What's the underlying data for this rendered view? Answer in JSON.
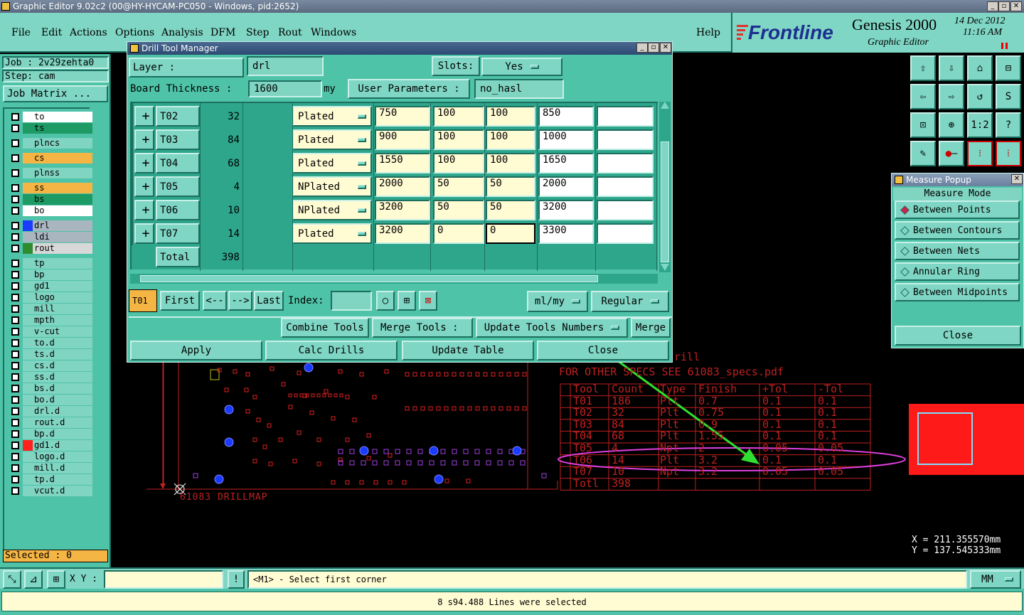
{
  "window": {
    "title": "Graphic Editor 9.02c2 (00@HY-HYCAM-PC050 - Windows, pid:2652)"
  },
  "menu": [
    "File",
    "Edit",
    "Actions",
    "Options",
    "Analysis",
    "DFM",
    "Step",
    "Rout",
    "Windows"
  ],
  "help_label": "Help",
  "brand": {
    "logo": "Frontline",
    "product": "Genesis 2000",
    "subtitle": "Graphic Editor",
    "date": "14 Dec 2012",
    "time": "11:16 AM"
  },
  "left": {
    "job": "Job : 2v29zehta0",
    "step": "Step: cam",
    "job_matrix": "Job Matrix ...",
    "selected": "Selected : 0",
    "layers": [
      {
        "name": "to",
        "color": "#ffffff",
        "bg": "#ffffff"
      },
      {
        "name": "ts",
        "color": "#1e9a64",
        "bg": "#1e9a64"
      },
      {
        "name": "plncs",
        "color": "#80d4c2",
        "bg": "#80d4c2"
      },
      {
        "name": "cs",
        "color": "#f5b544",
        "bg": "#f5b544"
      },
      {
        "name": "plnss",
        "color": "#80d4c2",
        "bg": "#80d4c2"
      },
      {
        "name": "ss",
        "color": "#f5b544",
        "bg": "#f5b544"
      },
      {
        "name": "bs",
        "color": "#1e9a64",
        "bg": "#1e9a64"
      },
      {
        "name": "bo",
        "color": "#ffffff",
        "bg": "#ffffff"
      },
      {
        "name": "drl",
        "color": "#1a3cff",
        "bg": "#a9b6c0"
      },
      {
        "name": "ldi",
        "color": "#a9b6c0",
        "bg": "#a9b6c0"
      },
      {
        "name": "rout",
        "color": "#2e8b2e",
        "bg": "#d8d8d8"
      },
      {
        "name": "tp",
        "color": "#80d4c2",
        "bg": "#80d4c2"
      },
      {
        "name": "bp",
        "color": "#80d4c2",
        "bg": "#80d4c2"
      },
      {
        "name": "gd1",
        "color": "#80d4c2",
        "bg": "#80d4c2"
      },
      {
        "name": "logo",
        "color": "#80d4c2",
        "bg": "#80d4c2"
      },
      {
        "name": "mill",
        "color": "#80d4c2",
        "bg": "#80d4c2"
      },
      {
        "name": "mpth",
        "color": "#80d4c2",
        "bg": "#80d4c2"
      },
      {
        "name": "v-cut",
        "color": "#80d4c2",
        "bg": "#80d4c2"
      },
      {
        "name": "to.d",
        "color": "#80d4c2",
        "bg": "#80d4c2"
      },
      {
        "name": "ts.d",
        "color": "#80d4c2",
        "bg": "#80d4c2"
      },
      {
        "name": "cs.d",
        "color": "#80d4c2",
        "bg": "#80d4c2"
      },
      {
        "name": "ss.d",
        "color": "#80d4c2",
        "bg": "#80d4c2"
      },
      {
        "name": "bs.d",
        "color": "#80d4c2",
        "bg": "#80d4c2"
      },
      {
        "name": "bo.d",
        "color": "#80d4c2",
        "bg": "#80d4c2"
      },
      {
        "name": "drl.d",
        "color": "#80d4c2",
        "bg": "#80d4c2"
      },
      {
        "name": "rout.d",
        "color": "#80d4c2",
        "bg": "#80d4c2"
      },
      {
        "name": "bp.d",
        "color": "#80d4c2",
        "bg": "#80d4c2"
      },
      {
        "name": "gd1.d",
        "color": "#ff2020",
        "bg": "#80d4c2"
      },
      {
        "name": "logo.d",
        "color": "#80d4c2",
        "bg": "#80d4c2"
      },
      {
        "name": "mill.d",
        "color": "#80d4c2",
        "bg": "#80d4c2"
      },
      {
        "name": "tp.d",
        "color": "#80d4c2",
        "bg": "#80d4c2"
      },
      {
        "name": "vcut.d",
        "color": "#80d4c2",
        "bg": "#80d4c2"
      }
    ]
  },
  "dtm": {
    "title": "Drill Tool Manager",
    "layer_label": "Layer :",
    "layer_value": "drl",
    "slots_label": "Slots:",
    "slots_value": "Yes",
    "thickness_label": "Board Thickness :",
    "thickness_value": "1600",
    "thickness_unit": "my",
    "user_params_label": "User Parameters :",
    "user_params_value": "no_hasl",
    "rows": [
      {
        "tool": "T02",
        "count": "32",
        "type": "Plated",
        "finish": "750",
        "tol_plus": "100",
        "tol_minus": "100",
        "drill": "850"
      },
      {
        "tool": "T03",
        "count": "84",
        "type": "Plated",
        "finish": "900",
        "tol_plus": "100",
        "tol_minus": "100",
        "drill": "1000"
      },
      {
        "tool": "T04",
        "count": "68",
        "type": "Plated",
        "finish": "1550",
        "tol_plus": "100",
        "tol_minus": "100",
        "drill": "1650"
      },
      {
        "tool": "T05",
        "count": "4",
        "type": "NPlated",
        "finish": "2000",
        "tol_plus": "50",
        "tol_minus": "50",
        "drill": "2000"
      },
      {
        "tool": "T06",
        "count": "10",
        "type": "NPlated",
        "finish": "3200",
        "tol_plus": "50",
        "tol_minus": "50",
        "drill": "3200"
      },
      {
        "tool": "T07",
        "count": "14",
        "type": "Plated",
        "finish": "3200",
        "tol_plus": "0",
        "tol_minus": "0",
        "drill": "3300"
      }
    ],
    "total_label": "Total",
    "total_value": "398",
    "current_tool": "T01",
    "nav": {
      "first": "First",
      "prev": "<--",
      "next": "-->",
      "last": "Last",
      "index": "Index:"
    },
    "units": "ml/my",
    "mode": "Regular",
    "combine": "Combine Tools",
    "merge_tools": "Merge Tools :",
    "update_numbers": "Update Tools Numbers",
    "merge": "Merge",
    "apply": "Apply",
    "calc": "Calc Drills",
    "update_table": "Update Table",
    "close": "Close"
  },
  "measure": {
    "title": "Measure Popup",
    "mode_label": "Measure Mode",
    "options": [
      "Between Points",
      "Between Contours",
      "Between Nets",
      "Annular Ring",
      "Between Midpoints"
    ],
    "close": "Close"
  },
  "coords": {
    "x": "X = 211.355570mm",
    "y": "Y = 137.545333mm"
  },
  "canvas_text": {
    "drillmap": "61083 DRILLMAP",
    "specs": "FOR OTHER SPECS SEE 61083_specs.pdf",
    "drill_fragment": "rill",
    "table_head": [
      "Tool",
      "Count",
      "Type",
      "Finish",
      "+Tol",
      "-Tol"
    ],
    "table_rows": [
      [
        "T01",
        "186",
        "Plt",
        "0.7",
        "0.1",
        "0.1"
      ],
      [
        "T02",
        "32",
        "Plt",
        "0.75",
        "0.1",
        "0.1"
      ],
      [
        "T03",
        "84",
        "Plt",
        "0.9",
        "0.1",
        "0.1"
      ],
      [
        "T04",
        "68",
        "Plt",
        "1.55",
        "0.1",
        "0.1"
      ],
      [
        "T05",
        "4",
        "Npt",
        "2",
        "0.05",
        "0.05"
      ],
      [
        "T06",
        "14",
        "Plt",
        "3.2",
        "0.1",
        "0.1"
      ],
      [
        "T07",
        "10",
        "Npt",
        "3.2",
        "0.05",
        "0.05"
      ],
      [
        "Totl",
        "398",
        "",
        "",
        "",
        ""
      ]
    ]
  },
  "bottom": {
    "xy_label": "X Y :",
    "prompt": "<M1> - Select first corner",
    "units": "MM",
    "status": "8 s94.488 Lines were selected"
  }
}
